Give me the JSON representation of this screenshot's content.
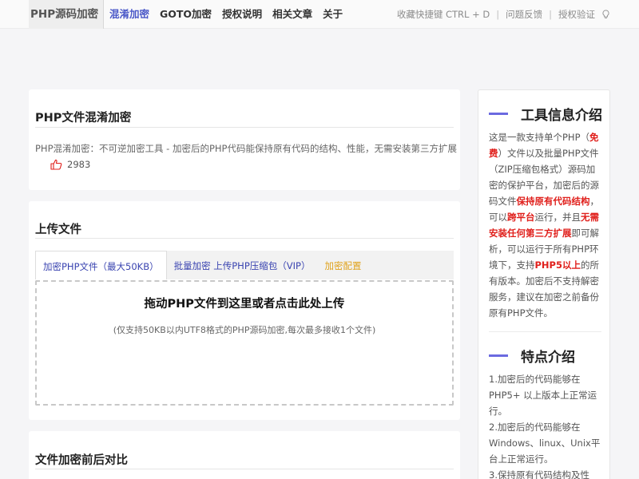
{
  "header": {
    "brand": "PHP源码加密",
    "nav": [
      "混淆加密",
      "GOTO加密",
      "授权说明",
      "相关文章",
      "关于"
    ],
    "right_links": [
      "收藏快捷键 CTRL + D",
      "问题反馈",
      "授权验证"
    ],
    "separator": "|",
    "accent_color": "#4a58c8"
  },
  "info_card": {
    "title": "PHP文件混淆加密",
    "description": "PHP混淆加密：不可逆加密工具 - 加密后的PHP代码能保持原有代码的结构、性能，无需安装第三方扩展",
    "like_count": "2983",
    "like_icon": "thumbs-up-icon"
  },
  "upload_card": {
    "title": "上传文件",
    "tabs": [
      "加密PHP文件（最大50KB）",
      "批量加密 上传PHP压缩包（VIP）",
      "加密配置"
    ],
    "dropzone_title": "拖动PHP文件到这里或者点击此处上传",
    "dropzone_sub": "(仅支持50KB以内UTF8格式的PHP源码加密,每次最多接收1个文件)"
  },
  "compare_card": {
    "title": "文件加密前后对比"
  },
  "sidebar": {
    "tool_title": "工具信息介绍",
    "tool_text": {
      "p1": "这是一款支持单个PHP（",
      "free": "免费",
      "p2": "）文件以及批量PHP文件（ZIP压缩包格式）源码加密的保护平台，加密后的源码文件",
      "keep": "保持原有代码结构",
      "p3": "，可以",
      "cross": "跨平台",
      "p4": "运行，并且",
      "noext": "无需安装任何第三方扩展",
      "p5": "即可解析，可以运行于所有PHP环境下，支持",
      "php5": "PHP5以上",
      "p6": "的所有版本。加密后不支持解密服务，建议在加密之前备份原有PHP文件。"
    },
    "feature_title": "特点介绍",
    "features": [
      "1.加密后的代码能够在PHP5+ 以上版本上正常运行。",
      "2.加密后的代码能够在Windows、linux、Unix平台上正常运行。",
      "3.保持原有代码结构及性"
    ],
    "accent_color": "#6b6ae0",
    "highlight_color": "#e0201c"
  }
}
